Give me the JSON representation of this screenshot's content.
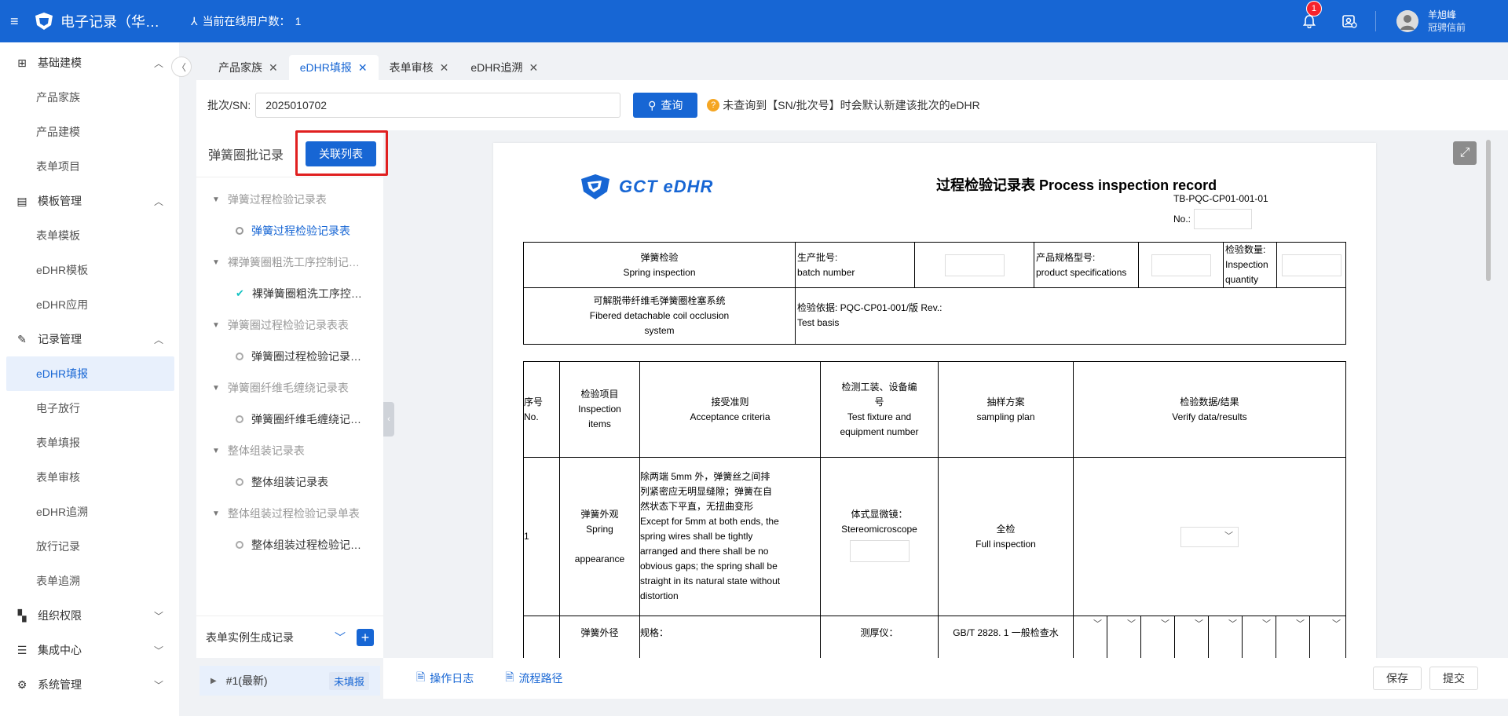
{
  "header": {
    "app_title": "电子记录（华…",
    "online_label": "当前在线用户数：",
    "online_count": "1",
    "notification_count": "1",
    "user_name": "羊旭峰",
    "user_role": "冠骋信前"
  },
  "sidebar": {
    "groups": [
      {
        "label": "基础建模",
        "icon": "grid-icon",
        "expanded": true,
        "items": [
          "产品家族",
          "产品建模",
          "表单项目"
        ]
      },
      {
        "label": "模板管理",
        "icon": "template-icon",
        "expanded": true,
        "items": [
          "表单模板",
          "eDHR模板",
          "eDHR应用"
        ]
      },
      {
        "label": "记录管理",
        "icon": "record-icon",
        "expanded": true,
        "items": [
          "eDHR填报",
          "电子放行",
          "表单填报",
          "表单审核",
          "eDHR追溯",
          "放行记录",
          "表单追溯"
        ]
      },
      {
        "label": "组织权限",
        "icon": "org-icon",
        "expanded": false,
        "items": []
      },
      {
        "label": "集成中心",
        "icon": "database-icon",
        "expanded": false,
        "items": []
      },
      {
        "label": "系统管理",
        "icon": "gear-icon",
        "expanded": false,
        "items": []
      }
    ],
    "active_item": "eDHR填报"
  },
  "tabs": [
    {
      "label": "产品家族",
      "active": false
    },
    {
      "label": "eDHR填报",
      "active": true
    },
    {
      "label": "表单审核",
      "active": false
    },
    {
      "label": "eDHR追溯",
      "active": false
    }
  ],
  "search": {
    "label": "批次/SN:",
    "value": "2025010702",
    "button": "查询",
    "hint": "未查询到【SN/批次号】时会默认新建该批次的eDHR"
  },
  "left_panel": {
    "title": "弹簧圈批记录",
    "link_button": "关联列表",
    "tree": [
      {
        "parent": "弹簧过程检验记录表",
        "child": "弹簧过程检验记录表",
        "child_state": "selected"
      },
      {
        "parent": "裸弹簧圈粗洗工序控制记…",
        "child": "裸弹簧圈粗洗工序控…",
        "child_state": "done"
      },
      {
        "parent": "弹簧圈过程检验记录表表",
        "child": "弹簧圈过程检验记录…",
        "child_state": "pending"
      },
      {
        "parent": "弹簧圈纤维毛缠绕记录表",
        "child": "弹簧圈纤维毛缠绕记…",
        "child_state": "pending"
      },
      {
        "parent": "整体组装记录表",
        "child": "整体组装记录表",
        "child_state": "pending"
      },
      {
        "parent": "整体组装过程检验记录单表",
        "child": "整体组装过程检验记…",
        "child_state": "pending"
      }
    ],
    "generation_label": "表单实例生成记录",
    "instance": {
      "name": "#1(最新)",
      "status": "未填报"
    }
  },
  "document": {
    "logo_text": "GCT eDHR",
    "title": "过程检验记录表 Process inspection record",
    "code": "TB-PQC-CP01-001-01",
    "no_label": "No.:",
    "header_table": {
      "spring_cn": "弹簧检验",
      "spring_en": "Spring inspection",
      "batch_cn": "生产批号:",
      "batch_en": "batch number",
      "spec_cn": "产品规格型号:",
      "spec_en": "product specifications",
      "qty_cn": "检验数量:",
      "qty_en1": "Inspection",
      "qty_en2": "quantity",
      "product_cn": "可解脱带纤维毛弹簧圈栓塞系统",
      "product_en1": "Fibered detachable coil occlusion",
      "product_en2": "system",
      "basis_cn": "检验依据: PQC-CP01-001/版 Rev.:",
      "basis_en": "Test basis"
    },
    "columns": {
      "no_cn": "序号",
      "no_en": "No.",
      "item_cn": "检验项目",
      "item_en1": "Inspection",
      "item_en2": "items",
      "acc_cn": "接受准则",
      "acc_en": "Acceptance criteria",
      "fix_cn1": "检测工装、设备编",
      "fix_cn2": "号",
      "fix_en1": "Test fixture and",
      "fix_en2": "equipment number",
      "plan_cn": "抽样方案",
      "plan_en": "sampling plan",
      "ver_cn": "检验数据/结果",
      "ver_en": "Verify data/results"
    },
    "row1": {
      "no": "1",
      "item_cn": "弹簧外观",
      "item_en1": "Spring",
      "item_en2": "appearance",
      "criteria": [
        "除两端 5mm 外，弹簧丝之间排",
        "列紧密应无明显缝隙；弹簧在自",
        "然状态下平直，无扭曲变形",
        "Except for 5mm at both ends, the",
        "spring wires shall be tightly",
        "arranged and there shall be no",
        "obvious gaps; the spring shall be",
        "straight in its natural state without",
        "distortion"
      ],
      "fixture_cn": "体式显微镜：",
      "fixture_en": "Stereomicroscope",
      "plan_cn": "全检",
      "plan_en": "Full inspection"
    },
    "row2": {
      "item_cn": "弹簧外径",
      "criteria": "规格：",
      "fixture_cn": "测厚仪：",
      "plan_cn": "GB/T 2828. 1 一般检查水"
    }
  },
  "bottom": {
    "log_link": "操作日志",
    "flow_link": "流程路径",
    "save": "保存",
    "submit": "提交"
  }
}
